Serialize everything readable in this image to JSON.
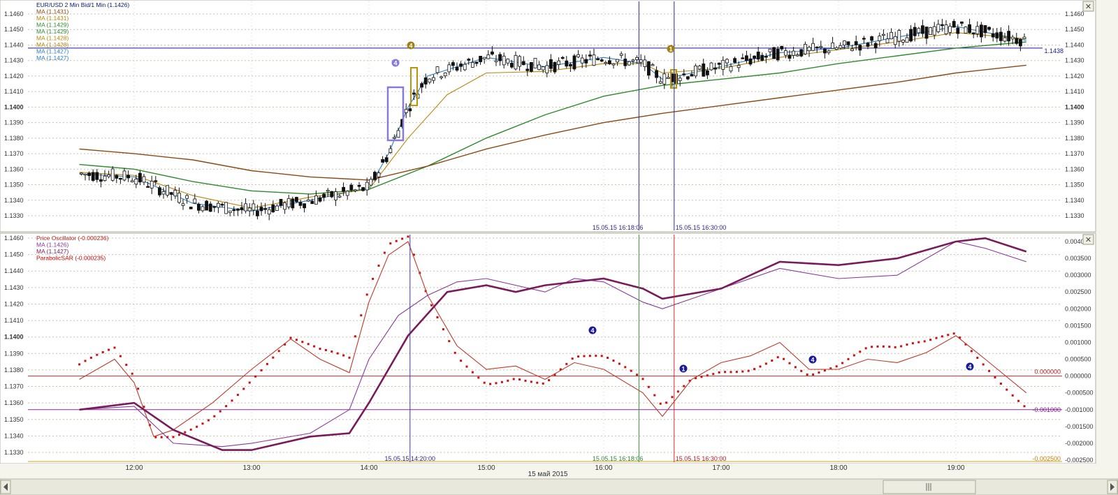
{
  "window": {
    "close_glyph": "✕",
    "bottom_date": "15 май 2015"
  },
  "upper_panel": {
    "legend": [
      {
        "text": "EUR/USD 2 Min Bid/1 Min (1.1426)",
        "color": "#0a1a6a"
      },
      {
        "text": "MA (1.1431)",
        "color": "#8b4a14"
      },
      {
        "text": "MA (1.1431)",
        "color": "#b8860b"
      },
      {
        "text": "MA (1.1429)",
        "color": "#2e8b2e"
      },
      {
        "text": "MA (1.1429)",
        "color": "#2e8b2e"
      },
      {
        "text": "MA (1.1428)",
        "color": "#b8860b"
      },
      {
        "text": "MA (1.1428)",
        "color": "#b8860b"
      },
      {
        "text": "MA (1.1427)",
        "color": "#2a7fc0"
      },
      {
        "text": "MA (1.1427)",
        "color": "#2a7fc0"
      }
    ],
    "y_ticks": [
      "1.1460",
      "1.1450",
      "1.1440",
      "1.1430",
      "1.1420",
      "1.1410",
      "1.1400",
      "1.1390",
      "1.1380",
      "1.1370",
      "1.1360",
      "1.1350",
      "1.1340",
      "1.1330"
    ],
    "price_marker": "1.1438",
    "vline_label_1": "15.05.15 16:18:06",
    "vline_label_2": "15.05.15 16:30:00",
    "markers": [
      "4",
      "4",
      "1"
    ]
  },
  "lower_panel": {
    "legend": [
      {
        "text": "Price Oscillator (-0.000236)",
        "color": "#b22222"
      },
      {
        "text": "MA (1.1426)",
        "color": "#8a3a9a"
      },
      {
        "text": "MA (1.1427)",
        "color": "#7a1a5a"
      },
      {
        "text": "ParabolicSAR (-0.000235)",
        "color": "#cc0000"
      }
    ],
    "y_ticks_left": [
      "1.1460",
      "1.1450",
      "1.1440",
      "1.1430",
      "1.1420",
      "1.1410",
      "1.1400",
      "1.1390",
      "1.1380",
      "1.1370",
      "1.1360",
      "1.1350",
      "1.1340",
      "1.1330"
    ],
    "y_ticks_right": [
      "0.004000",
      "0.003500",
      "0.003000",
      "0.002500",
      "0.002000",
      "0.001500",
      "0.001000",
      "0.000500",
      "0.000000",
      "-0.000500",
      "-0.001000",
      "-0.001500",
      "-0.002000",
      "-0.002500"
    ],
    "zero_label": "0.000000",
    "neg_label": "-0.001000",
    "bottom_label": "-0.002500",
    "vline_label_1": "15.05.15 14:20:00",
    "vline_label_2": "15.05.15 16:18:06",
    "vline_label_3": "15.05.15 16:30:00",
    "markers": [
      "4",
      "1",
      "4",
      "4"
    ]
  },
  "x_axis": {
    "ticks": [
      "12:00",
      "13:00",
      "14:00",
      "15:00",
      "16:00",
      "17:00",
      "18:00",
      "19:00"
    ]
  },
  "chart_data": [
    {
      "type": "candlestick",
      "title": "EUR/USD 2 Min Bid/1 Min (1.1426)",
      "ylim": [
        1.1323,
        1.1465
      ],
      "xlim": [
        "11:32",
        "19:36"
      ],
      "moving_averages": [
        {
          "name": "MA (1.1427)",
          "color": "#2a7fc0",
          "x": [
            "11:32",
            "12:00",
            "12:30",
            "13:00",
            "13:30",
            "14:00",
            "14:10",
            "14:20",
            "14:30",
            "15:00",
            "15:30",
            "16:00",
            "16:20",
            "16:30",
            "17:00",
            "17:30",
            "18:00",
            "18:30",
            "19:00",
            "19:36"
          ],
          "y": [
            1.1357,
            1.1355,
            1.1338,
            1.1333,
            1.134,
            1.1348,
            1.137,
            1.14,
            1.142,
            1.1432,
            1.1426,
            1.1432,
            1.1428,
            1.1418,
            1.1426,
            1.1435,
            1.1438,
            1.1445,
            1.1452,
            1.1443
          ]
        },
        {
          "name": "MA (1.1428)",
          "color": "#b8860b",
          "x": [
            "11:32",
            "12:00",
            "12:30",
            "13:00",
            "13:30",
            "14:00",
            "14:20",
            "14:40",
            "15:00",
            "15:30",
            "16:00",
            "16:20",
            "16:30",
            "17:00",
            "17:30",
            "18:00",
            "18:30",
            "19:00",
            "19:36"
          ],
          "y": [
            1.1358,
            1.1356,
            1.1343,
            1.1335,
            1.1342,
            1.1347,
            1.138,
            1.1408,
            1.1422,
            1.1423,
            1.1428,
            1.1428,
            1.1422,
            1.1425,
            1.1432,
            1.1437,
            1.1442,
            1.1448,
            1.1444
          ]
        },
        {
          "name": "MA (1.1429)",
          "color": "#2e8b2e",
          "x": [
            "11:32",
            "12:00",
            "12:30",
            "13:00",
            "13:30",
            "14:00",
            "14:30",
            "15:00",
            "15:30",
            "16:00",
            "16:30",
            "17:00",
            "17:30",
            "18:00",
            "18:30",
            "19:00",
            "19:36"
          ],
          "y": [
            1.1363,
            1.136,
            1.1352,
            1.1346,
            1.1344,
            1.1347,
            1.1362,
            1.138,
            1.1395,
            1.1407,
            1.1414,
            1.1418,
            1.1422,
            1.1428,
            1.1433,
            1.1438,
            1.1442
          ]
        },
        {
          "name": "MA (1.1431)",
          "color": "#8b4a14",
          "x": [
            "11:32",
            "12:00",
            "12:30",
            "13:00",
            "13:30",
            "14:00",
            "14:30",
            "15:00",
            "15:30",
            "16:00",
            "16:30",
            "17:00",
            "17:30",
            "18:00",
            "18:30",
            "19:00",
            "19:36"
          ],
          "y": [
            1.1373,
            1.137,
            1.1366,
            1.1359,
            1.1355,
            1.1353,
            1.1362,
            1.1373,
            1.1382,
            1.139,
            1.1396,
            1.1401,
            1.1406,
            1.1411,
            1.1416,
            1.1422,
            1.1427
          ]
        }
      ],
      "horizontal_line": 1.1438
    },
    {
      "type": "line",
      "title": "Price Oscillator (-0.000236)",
      "ylim": [
        -0.0025,
        0.0042
      ],
      "series": [
        {
          "name": "Price Oscillator (-0.000236)",
          "color": "#c0392b",
          "x": [
            "11:32",
            "11:50",
            "12:00",
            "12:10",
            "12:20",
            "12:40",
            "13:00",
            "13:20",
            "13:35",
            "13:50",
            "14:00",
            "14:10",
            "14:20",
            "14:30",
            "14:45",
            "15:00",
            "15:15",
            "15:30",
            "15:45",
            "16:00",
            "16:20",
            "16:30",
            "16:45",
            "17:00",
            "17:15",
            "17:30",
            "17:45",
            "18:00",
            "18:15",
            "18:30",
            "18:45",
            "19:00",
            "19:15",
            "19:36"
          ],
          "y": [
            -0.0001,
            0.0005,
            -0.0002,
            -0.0018,
            -0.0016,
            -0.0008,
            0.0002,
            0.0011,
            0.0005,
            0.0001,
            0.0022,
            0.0036,
            0.004,
            0.0024,
            0.0009,
            0.0002,
            0.0003,
            -0.0001,
            0.0004,
            0.0002,
            -0.0005,
            -0.0012,
            -0.0001,
            0.0004,
            0.0006,
            0.001,
            0.0002,
            0.0002,
            0.0005,
            0.0004,
            0.0007,
            0.0012,
            0.0005,
            -0.0005
          ]
        },
        {
          "name": "MA (1.1426)",
          "color": "#8a3a9a",
          "x": [
            "11:32",
            "12:00",
            "12:20",
            "12:45",
            "13:00",
            "13:30",
            "13:50",
            "14:00",
            "14:15",
            "14:30",
            "14:45",
            "15:00",
            "15:30",
            "15:45",
            "16:00",
            "16:20",
            "16:30",
            "17:00",
            "17:30",
            "18:00",
            "18:30",
            "19:00",
            "19:15",
            "19:36"
          ],
          "y": [
            -0.001,
            -0.0009,
            -0.002,
            -0.0021,
            -0.002,
            -0.0017,
            -0.001,
            0.0005,
            0.0018,
            0.0024,
            0.0028,
            0.0029,
            0.0025,
            0.0029,
            0.0028,
            0.0022,
            0.002,
            0.0026,
            0.0032,
            0.0029,
            0.003,
            0.004,
            0.0038,
            0.0034
          ]
        },
        {
          "name": "MA (1.1427)",
          "color": "#7a1a5a",
          "x": [
            "11:32",
            "12:00",
            "12:20",
            "12:45",
            "13:00",
            "13:30",
            "13:50",
            "14:00",
            "14:20",
            "14:40",
            "15:00",
            "15:15",
            "15:30",
            "16:00",
            "16:20",
            "16:30",
            "17:00",
            "17:30",
            "18:00",
            "18:30",
            "19:00",
            "19:15",
            "19:36"
          ],
          "y": [
            -0.001,
            -0.0008,
            -0.0016,
            -0.0022,
            -0.0022,
            -0.0018,
            -0.0017,
            -0.0008,
            0.0012,
            0.0025,
            0.0027,
            0.0025,
            0.0027,
            0.0029,
            0.0026,
            0.0023,
            0.0026,
            0.0034,
            0.0033,
            0.0035,
            0.004,
            0.0041,
            0.0037
          ]
        }
      ],
      "reference_lines": [
        0.0,
        -0.001
      ]
    }
  ]
}
